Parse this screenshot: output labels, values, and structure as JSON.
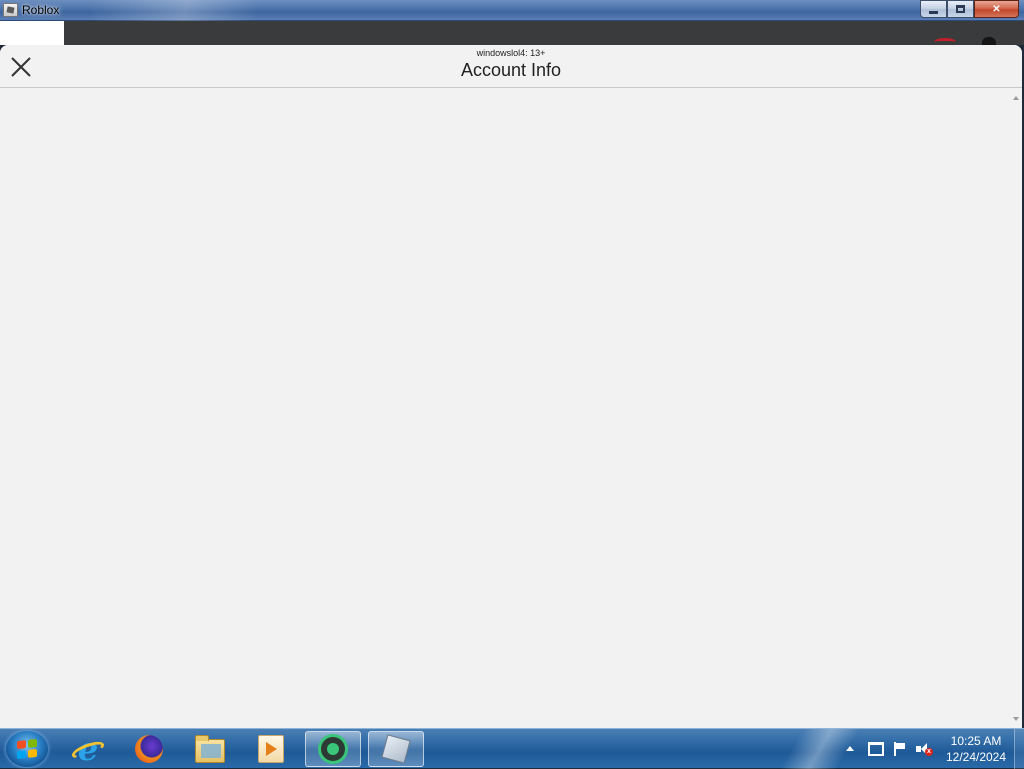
{
  "window": {
    "title": "Roblox",
    "minimize_label": "",
    "maximize_label": "",
    "close_label": "✕"
  },
  "modal": {
    "username": "windowslol4: 13+",
    "title": "Account Info"
  },
  "taskbar": {
    "pinned": [
      {
        "name": "Internet Explorer",
        "icon": "internet-explorer-icon"
      },
      {
        "name": "Firefox",
        "icon": "firefox-icon"
      },
      {
        "name": "Windows Explorer",
        "icon": "folder-icon"
      },
      {
        "name": "Media Player",
        "icon": "media-player-icon"
      },
      {
        "name": "Green App",
        "icon": "green-app-icon",
        "active": true
      },
      {
        "name": "Roblox",
        "icon": "roblox-icon",
        "active": true
      }
    ],
    "tray": {
      "time": "10:25 AM",
      "date": "12/24/2024"
    }
  },
  "colors": {
    "modal_background": "#f2f2f2",
    "taskbar": "#2f6aa6",
    "title_text": "#222222"
  }
}
